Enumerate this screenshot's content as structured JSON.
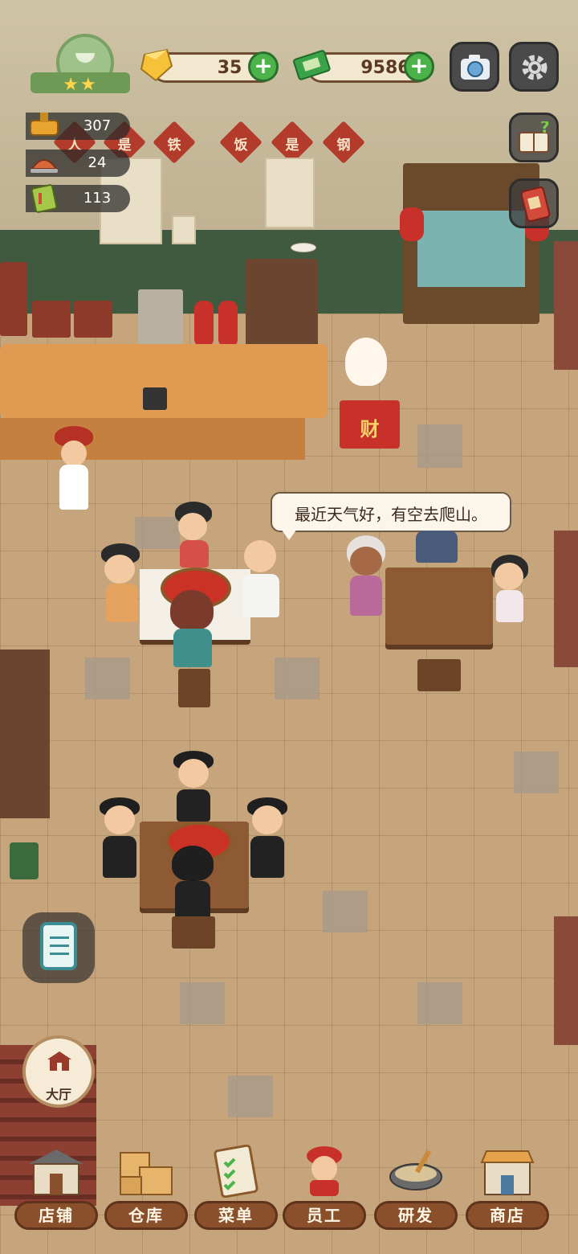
{
  "hud": {
    "rank_stars": "★★",
    "gems": "35",
    "cash": "9586",
    "stats": {
      "hotpot_count": "307",
      "served_count": "24",
      "recipe_count": "113"
    }
  },
  "wall_slogan": [
    "人",
    "是",
    "铁",
    "饭",
    "是",
    "钢"
  ],
  "shrine_label": "财",
  "speech_bubble": "最近天气好，有空去爬山。",
  "hall_button_label": "大厅",
  "bottom_nav": [
    {
      "label": "店铺",
      "icon": "shop-front-icon"
    },
    {
      "label": "仓库",
      "icon": "warehouse-boxes-icon"
    },
    {
      "label": "菜单",
      "icon": "menu-checklist-icon"
    },
    {
      "label": "员工",
      "icon": "staff-chef-icon"
    },
    {
      "label": "研发",
      "icon": "wok-research-icon"
    },
    {
      "label": "商店",
      "icon": "store-icon"
    }
  ],
  "colors": {
    "plus_button": "#4bb34a",
    "nav_label_bg": "#8a4f2b",
    "hotpot_red": "#c93224"
  }
}
